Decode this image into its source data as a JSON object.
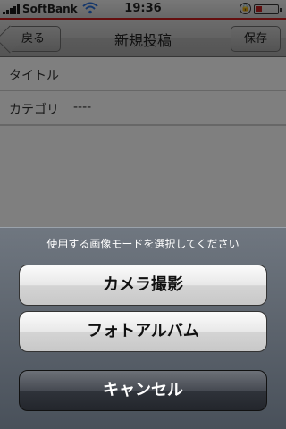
{
  "status_bar": {
    "carrier": "SoftBank",
    "time": "19:36",
    "battery_level": 0.3,
    "battery_color": "#c02020"
  },
  "nav": {
    "back_label": "戻る",
    "title": "新規投稿",
    "save_label": "保存"
  },
  "form": {
    "title_label": "タイトル",
    "category_label": "カテゴリ",
    "category_value": "----"
  },
  "action_sheet": {
    "title": "使用する画像モードを選択してください",
    "buttons": {
      "camera": "カメラ撮影",
      "photo_album": "フォトアルバム",
      "cancel": "キャンセル"
    }
  },
  "colors": {
    "nav_accent": "#c91c1c"
  },
  "icons": {
    "signal": "signal-bars-icon",
    "wifi": "wifi-icon",
    "rotation_lock": "rotation-lock-icon",
    "battery": "battery-icon"
  }
}
